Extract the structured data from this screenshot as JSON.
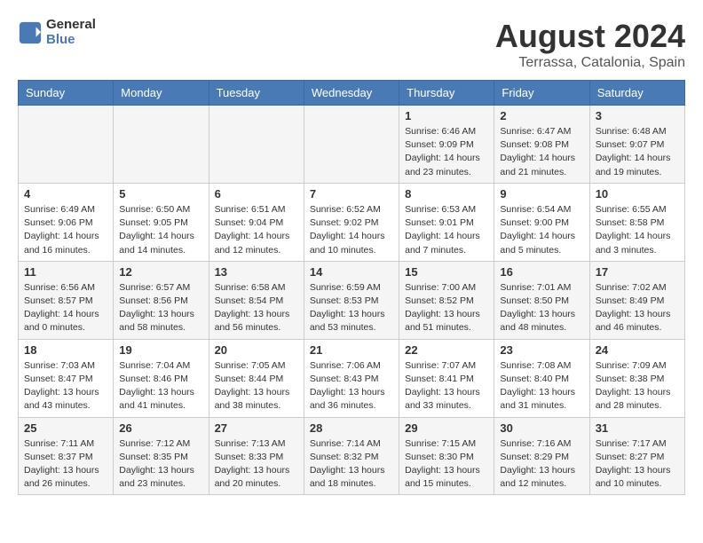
{
  "logo": {
    "line1": "General",
    "line2": "Blue"
  },
  "title": "August 2024",
  "subtitle": "Terrassa, Catalonia, Spain",
  "days_of_week": [
    "Sunday",
    "Monday",
    "Tuesday",
    "Wednesday",
    "Thursday",
    "Friday",
    "Saturday"
  ],
  "weeks": [
    [
      {
        "day": "",
        "info": ""
      },
      {
        "day": "",
        "info": ""
      },
      {
        "day": "",
        "info": ""
      },
      {
        "day": "",
        "info": ""
      },
      {
        "day": "1",
        "info": "Sunrise: 6:46 AM\nSunset: 9:09 PM\nDaylight: 14 hours and 23 minutes."
      },
      {
        "day": "2",
        "info": "Sunrise: 6:47 AM\nSunset: 9:08 PM\nDaylight: 14 hours and 21 minutes."
      },
      {
        "day": "3",
        "info": "Sunrise: 6:48 AM\nSunset: 9:07 PM\nDaylight: 14 hours and 19 minutes."
      }
    ],
    [
      {
        "day": "4",
        "info": "Sunrise: 6:49 AM\nSunset: 9:06 PM\nDaylight: 14 hours and 16 minutes."
      },
      {
        "day": "5",
        "info": "Sunrise: 6:50 AM\nSunset: 9:05 PM\nDaylight: 14 hours and 14 minutes."
      },
      {
        "day": "6",
        "info": "Sunrise: 6:51 AM\nSunset: 9:04 PM\nDaylight: 14 hours and 12 minutes."
      },
      {
        "day": "7",
        "info": "Sunrise: 6:52 AM\nSunset: 9:02 PM\nDaylight: 14 hours and 10 minutes."
      },
      {
        "day": "8",
        "info": "Sunrise: 6:53 AM\nSunset: 9:01 PM\nDaylight: 14 hours and 7 minutes."
      },
      {
        "day": "9",
        "info": "Sunrise: 6:54 AM\nSunset: 9:00 PM\nDaylight: 14 hours and 5 minutes."
      },
      {
        "day": "10",
        "info": "Sunrise: 6:55 AM\nSunset: 8:58 PM\nDaylight: 14 hours and 3 minutes."
      }
    ],
    [
      {
        "day": "11",
        "info": "Sunrise: 6:56 AM\nSunset: 8:57 PM\nDaylight: 14 hours and 0 minutes."
      },
      {
        "day": "12",
        "info": "Sunrise: 6:57 AM\nSunset: 8:56 PM\nDaylight: 13 hours and 58 minutes."
      },
      {
        "day": "13",
        "info": "Sunrise: 6:58 AM\nSunset: 8:54 PM\nDaylight: 13 hours and 56 minutes."
      },
      {
        "day": "14",
        "info": "Sunrise: 6:59 AM\nSunset: 8:53 PM\nDaylight: 13 hours and 53 minutes."
      },
      {
        "day": "15",
        "info": "Sunrise: 7:00 AM\nSunset: 8:52 PM\nDaylight: 13 hours and 51 minutes."
      },
      {
        "day": "16",
        "info": "Sunrise: 7:01 AM\nSunset: 8:50 PM\nDaylight: 13 hours and 48 minutes."
      },
      {
        "day": "17",
        "info": "Sunrise: 7:02 AM\nSunset: 8:49 PM\nDaylight: 13 hours and 46 minutes."
      }
    ],
    [
      {
        "day": "18",
        "info": "Sunrise: 7:03 AM\nSunset: 8:47 PM\nDaylight: 13 hours and 43 minutes."
      },
      {
        "day": "19",
        "info": "Sunrise: 7:04 AM\nSunset: 8:46 PM\nDaylight: 13 hours and 41 minutes."
      },
      {
        "day": "20",
        "info": "Sunrise: 7:05 AM\nSunset: 8:44 PM\nDaylight: 13 hours and 38 minutes."
      },
      {
        "day": "21",
        "info": "Sunrise: 7:06 AM\nSunset: 8:43 PM\nDaylight: 13 hours and 36 minutes."
      },
      {
        "day": "22",
        "info": "Sunrise: 7:07 AM\nSunset: 8:41 PM\nDaylight: 13 hours and 33 minutes."
      },
      {
        "day": "23",
        "info": "Sunrise: 7:08 AM\nSunset: 8:40 PM\nDaylight: 13 hours and 31 minutes."
      },
      {
        "day": "24",
        "info": "Sunrise: 7:09 AM\nSunset: 8:38 PM\nDaylight: 13 hours and 28 minutes."
      }
    ],
    [
      {
        "day": "25",
        "info": "Sunrise: 7:11 AM\nSunset: 8:37 PM\nDaylight: 13 hours and 26 minutes."
      },
      {
        "day": "26",
        "info": "Sunrise: 7:12 AM\nSunset: 8:35 PM\nDaylight: 13 hours and 23 minutes."
      },
      {
        "day": "27",
        "info": "Sunrise: 7:13 AM\nSunset: 8:33 PM\nDaylight: 13 hours and 20 minutes."
      },
      {
        "day": "28",
        "info": "Sunrise: 7:14 AM\nSunset: 8:32 PM\nDaylight: 13 hours and 18 minutes."
      },
      {
        "day": "29",
        "info": "Sunrise: 7:15 AM\nSunset: 8:30 PM\nDaylight: 13 hours and 15 minutes."
      },
      {
        "day": "30",
        "info": "Sunrise: 7:16 AM\nSunset: 8:29 PM\nDaylight: 13 hours and 12 minutes."
      },
      {
        "day": "31",
        "info": "Sunrise: 7:17 AM\nSunset: 8:27 PM\nDaylight: 13 hours and 10 minutes."
      }
    ]
  ]
}
